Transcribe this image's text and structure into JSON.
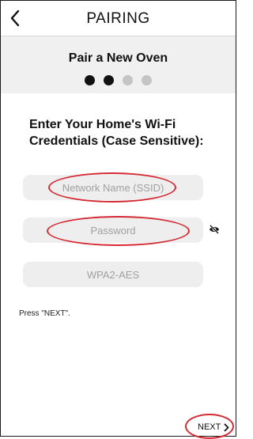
{
  "header": {
    "title": "PAIRING"
  },
  "progress": {
    "title": "Pair a New Oven",
    "steps": [
      {
        "state": "complete",
        "color": "#111111"
      },
      {
        "state": "current",
        "color": "#111111"
      },
      {
        "state": "upcoming",
        "color": "#c4c4c4"
      },
      {
        "state": "upcoming",
        "color": "#c4c4c4"
      }
    ]
  },
  "form": {
    "instructions": "Enter Your Home's Wi-Fi Credentials (Case Sensitive):",
    "ssid_placeholder": "Network Name (SSID)",
    "password_placeholder": "Password",
    "security_value": "WPA2-AES"
  },
  "hint": "Press \"NEXT\".",
  "footer": {
    "next_label": "NEXT"
  },
  "icons": {
    "back": "chevron-left-icon",
    "password_visibility": "eye-off-icon",
    "next": "chevron-right-icon"
  },
  "colors": {
    "annotation": "#d42a34",
    "band": "#f0f0f0",
    "field": "#eeeeee"
  }
}
